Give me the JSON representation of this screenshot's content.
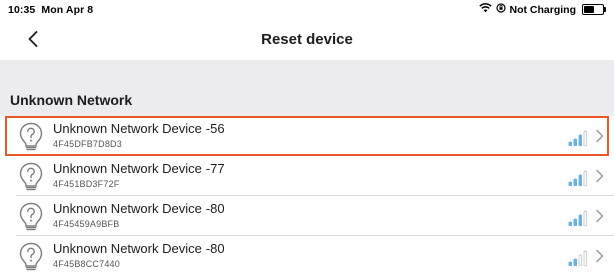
{
  "status_bar": {
    "time": "10:35",
    "date": "Mon Apr 8",
    "charging": "Not Charging",
    "battery_level": 0.65
  },
  "nav": {
    "back_icon": "chevron-left-icon",
    "title": "Reset device"
  },
  "section": {
    "title": "Unknown Network"
  },
  "devices": [
    {
      "name": "Unknown Network Device",
      "rssi": "-56",
      "mac": "4F45DFB7D8D3",
      "signal_bars": 3,
      "selected": true
    },
    {
      "name": "Unknown Network Device",
      "rssi": "-77",
      "mac": "4F451BD3F72F",
      "signal_bars": 3,
      "selected": false
    },
    {
      "name": "Unknown Network Device",
      "rssi": "-80",
      "mac": "4F45459A9BFB",
      "signal_bars": 3,
      "selected": false
    },
    {
      "name": "Unknown Network Device",
      "rssi": "-80",
      "mac": "4F45B8CC7440",
      "signal_bars": 2,
      "selected": false
    }
  ],
  "colors": {
    "accent_selected": "#e9572a",
    "signal_active": "#6ab0dc",
    "signal_inactive": "#c9c9cd",
    "section_bg": "#ececee"
  }
}
